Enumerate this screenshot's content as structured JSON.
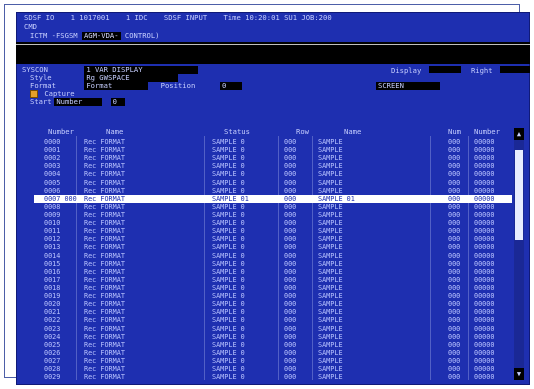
{
  "header": {
    "line1": [
      "SDSF IO",
      "1 1017001",
      "1 IDC",
      "SDSF INPUT",
      "Time 10:20:01 SU1 JOB:200"
    ],
    "line2": "CMD",
    "line3_prefix": "ICTM -FSGSM",
    "line3_box": "AGM-VDA-",
    "line3_suffix": "CONTROL)"
  },
  "section": {
    "name_label": "SYSCON",
    "name_value": "1 VAR DISPLAY",
    "style_label": "Style",
    "style_value": "Rg GWSPACE",
    "format_label": "Format",
    "format_value": "Format",
    "position_label": "Position",
    "position_value": "0",
    "capture_label": "Capture",
    "start_label": "Start",
    "start_value": "Number",
    "start_num": "0",
    "right_label1": "Display",
    "right_box1": "",
    "right_label2": "Right",
    "right_box2": "",
    "mode_value": "SCREEN"
  },
  "table": {
    "columns": [
      "Number",
      "Name",
      "Status",
      "Row",
      "Name",
      "Num",
      "Number"
    ],
    "rows": [
      [
        "0000",
        "Rec FORMAT",
        "SAMPLE 0",
        "000",
        "SAMPLE",
        "000",
        "00000"
      ],
      [
        "0001",
        "Rec FORMAT",
        "SAMPLE 0",
        "000",
        "SAMPLE",
        "000",
        "00000"
      ],
      [
        "0002",
        "Rec FORMAT",
        "SAMPLE 0",
        "000",
        "SAMPLE",
        "000",
        "00000"
      ],
      [
        "0003",
        "Rec FORMAT",
        "SAMPLE 0",
        "000",
        "SAMPLE",
        "000",
        "00000"
      ],
      [
        "0004",
        "Rec FORMAT",
        "SAMPLE 0",
        "000",
        "SAMPLE",
        "000",
        "00000"
      ],
      [
        "0005",
        "Rec FORMAT",
        "SAMPLE 0",
        "000",
        "SAMPLE",
        "000",
        "00000"
      ],
      [
        "0006",
        "Rec FORMAT",
        "SAMPLE 0",
        "000",
        "SAMPLE",
        "000",
        "00000"
      ],
      [
        "0007 000",
        "Rec FORMAT",
        "SAMPLE 01",
        "000",
        "SAMPLE 01",
        "000",
        "00000"
      ],
      [
        "0008",
        "Rec FORMAT",
        "SAMPLE 0",
        "000",
        "SAMPLE",
        "000",
        "00000"
      ],
      [
        "0009",
        "Rec FORMAT",
        "SAMPLE 0",
        "000",
        "SAMPLE",
        "000",
        "00000"
      ],
      [
        "0010",
        "Rec FORMAT",
        "SAMPLE 0",
        "000",
        "SAMPLE",
        "000",
        "00000"
      ],
      [
        "0011",
        "Rec FORMAT",
        "SAMPLE 0",
        "000",
        "SAMPLE",
        "000",
        "00000"
      ],
      [
        "0012",
        "Rec FORMAT",
        "SAMPLE 0",
        "000",
        "SAMPLE",
        "000",
        "00000"
      ],
      [
        "0013",
        "Rec FORMAT",
        "SAMPLE 0",
        "000",
        "SAMPLE",
        "000",
        "00000"
      ],
      [
        "0014",
        "Rec FORMAT",
        "SAMPLE 0",
        "000",
        "SAMPLE",
        "000",
        "00000"
      ],
      [
        "0015",
        "Rec FORMAT",
        "SAMPLE 0",
        "000",
        "SAMPLE",
        "000",
        "00000"
      ],
      [
        "0016",
        "Rec FORMAT",
        "SAMPLE 0",
        "000",
        "SAMPLE",
        "000",
        "00000"
      ],
      [
        "0017",
        "Rec FORMAT",
        "SAMPLE 0",
        "000",
        "SAMPLE",
        "000",
        "00000"
      ],
      [
        "0018",
        "Rec FORMAT",
        "SAMPLE 0",
        "000",
        "SAMPLE",
        "000",
        "00000"
      ],
      [
        "0019",
        "Rec FORMAT",
        "SAMPLE 0",
        "000",
        "SAMPLE",
        "000",
        "00000"
      ],
      [
        "0020",
        "Rec FORMAT",
        "SAMPLE 0",
        "000",
        "SAMPLE",
        "000",
        "00000"
      ],
      [
        "0021",
        "Rec FORMAT",
        "SAMPLE 0",
        "000",
        "SAMPLE",
        "000",
        "00000"
      ],
      [
        "0022",
        "Rec FORMAT",
        "SAMPLE 0",
        "000",
        "SAMPLE",
        "000",
        "00000"
      ],
      [
        "0023",
        "Rec FORMAT",
        "SAMPLE 0",
        "000",
        "SAMPLE",
        "000",
        "00000"
      ],
      [
        "0024",
        "Rec FORMAT",
        "SAMPLE 0",
        "000",
        "SAMPLE",
        "000",
        "00000"
      ],
      [
        "0025",
        "Rec FORMAT",
        "SAMPLE 0",
        "000",
        "SAMPLE",
        "000",
        "00000"
      ],
      [
        "0026",
        "Rec FORMAT",
        "SAMPLE 0",
        "000",
        "SAMPLE",
        "000",
        "00000"
      ],
      [
        "0027",
        "Rec FORMAT",
        "SAMPLE 0",
        "000",
        "SAMPLE",
        "000",
        "00000"
      ],
      [
        "0028",
        "Rec FORMAT",
        "SAMPLE 0",
        "000",
        "SAMPLE",
        "000",
        "00000"
      ],
      [
        "0029",
        "Rec FORMAT",
        "SAMPLE 0",
        "000",
        "SAMPLE",
        "000",
        "00000"
      ]
    ],
    "selected_index": 7
  },
  "scrollbar": {
    "up": "▲",
    "down": "▼"
  },
  "colors": {
    "screen_bg": "#1e2fb0",
    "text": "#c7cfff",
    "highlight": "#ffffff",
    "capture_icon": "#e5a02a"
  }
}
